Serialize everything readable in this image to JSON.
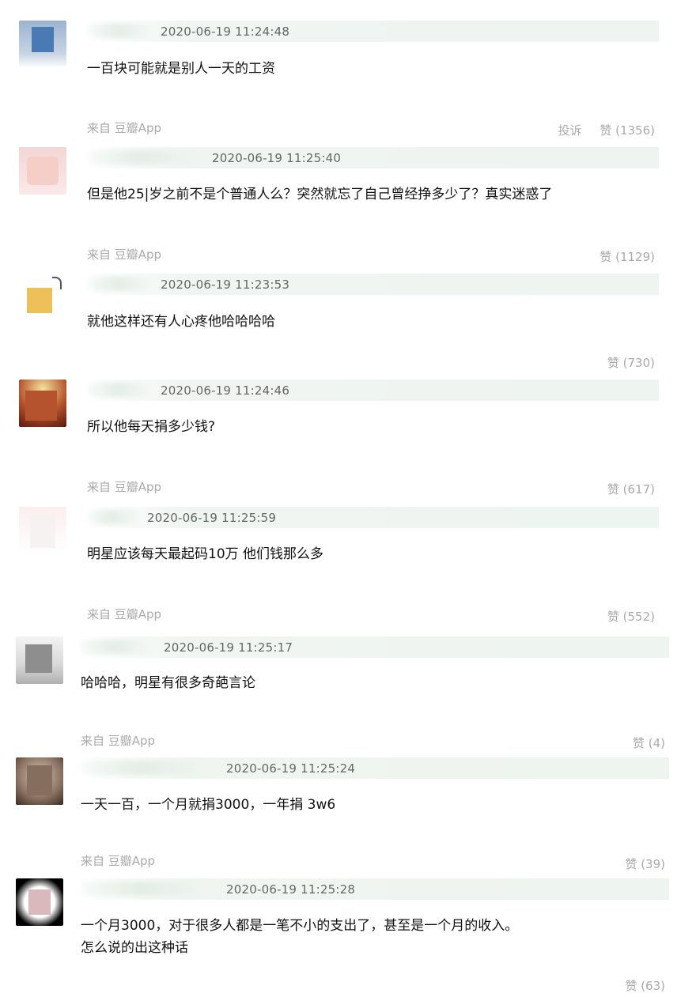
{
  "comments": [
    {
      "timestamp": "2020-06-19 11:24:48",
      "text": "一百块可能就是别人一天的工资",
      "source": "来自 豆瓣App",
      "report": "投诉",
      "likes": "赞 (1356)"
    },
    {
      "timestamp": "2020-06-19 11:25:40",
      "text": "但是他25|岁之前不是个普通人么？突然就忘了自己曾经挣多少了？真实迷惑了",
      "source": "来自 豆瓣App",
      "likes": "赞 (1129)"
    },
    {
      "timestamp": "2020-06-19 11:23:53",
      "text": "就他这样还有人心疼他哈哈哈哈",
      "likes": "赞 (730)"
    },
    {
      "timestamp": "2020-06-19 11:24:46",
      "text": "所以他每天捐多少钱?",
      "source": "来自 豆瓣App",
      "likes": "赞 (617)"
    },
    {
      "timestamp": "2020-06-19 11:25:59",
      "text": "明星应该每天最起码10万 他们钱那么多",
      "source": "来自 豆瓣App",
      "likes": "赞 (552)"
    },
    {
      "timestamp": "2020-06-19 11:25:17",
      "text": "哈哈哈，明星有很多奇葩言论",
      "source": "来自 豆瓣App",
      "likes": "赞 (4)"
    },
    {
      "timestamp": "2020-06-19 11:25:24",
      "text": "一天一百，一个月就捐3000，一年捐 3w6",
      "source": "来自 豆瓣App",
      "likes": "赞 (39)"
    },
    {
      "timestamp": "2020-06-19 11:25:28",
      "text_line1": "一个月3000，对于很多人都是一笔不小的支出了，甚至是一个月的收入。",
      "text_line2": "怎么说的出这种话",
      "likes": "赞 (63)"
    }
  ]
}
